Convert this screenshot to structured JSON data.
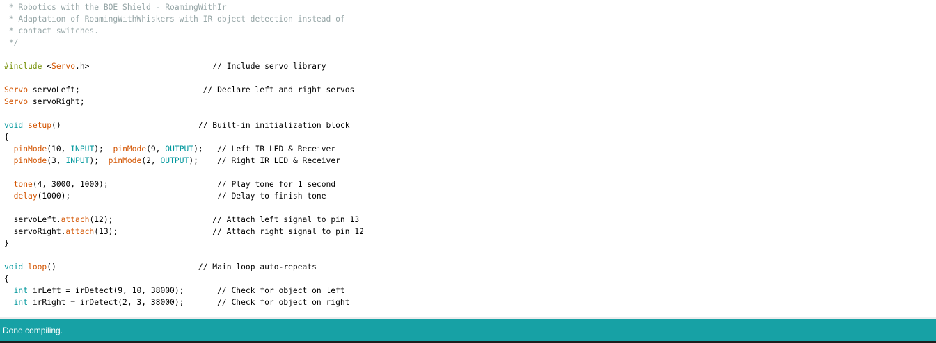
{
  "colors": {
    "comment": "#95a5a6",
    "keyword": "#d35400",
    "type": "#00979c",
    "preprocessor": "#728e00",
    "plain": "#000000",
    "status_bar_bg": "#17a1a5",
    "status_text": "#ffffff"
  },
  "editor": {
    "lines": [
      [
        {
          "t": " * Robotics with the BOE Shield - RoamingWithIr",
          "k": "comment"
        }
      ],
      [
        {
          "t": " * Adaptation of RoamingWithWhiskers with IR object detection instead of",
          "k": "comment"
        }
      ],
      [
        {
          "t": " * contact switches.",
          "k": "comment"
        }
      ],
      [
        {
          "t": " */",
          "k": "comment"
        }
      ],
      [],
      [
        {
          "t": "#include ",
          "k": "preproc"
        },
        {
          "t": "<",
          "k": "plain"
        },
        {
          "t": "Servo",
          "k": "keyword"
        },
        {
          "t": ".h>",
          "k": "plain"
        },
        {
          "t": "                          ",
          "k": "plain"
        },
        {
          "t": "// Include servo library",
          "k": "plain"
        }
      ],
      [],
      [
        {
          "t": "Servo",
          "k": "keyword"
        },
        {
          "t": " servoLeft;                          ",
          "k": "plain"
        },
        {
          "t": "// Declare left and right servos",
          "k": "plain"
        }
      ],
      [
        {
          "t": "Servo",
          "k": "keyword"
        },
        {
          "t": " servoRight;",
          "k": "plain"
        }
      ],
      [],
      [
        {
          "t": "void",
          "k": "type"
        },
        {
          "t": " ",
          "k": "plain"
        },
        {
          "t": "setup",
          "k": "keyword"
        },
        {
          "t": "()                             ",
          "k": "plain"
        },
        {
          "t": "// Built-in initialization block",
          "k": "plain"
        }
      ],
      [
        {
          "t": "{",
          "k": "plain"
        }
      ],
      [
        {
          "t": "  ",
          "k": "plain"
        },
        {
          "t": "pinMode",
          "k": "keyword"
        },
        {
          "t": "(10, ",
          "k": "plain"
        },
        {
          "t": "INPUT",
          "k": "type"
        },
        {
          "t": ");  ",
          "k": "plain"
        },
        {
          "t": "pinMode",
          "k": "keyword"
        },
        {
          "t": "(9, ",
          "k": "plain"
        },
        {
          "t": "OUTPUT",
          "k": "type"
        },
        {
          "t": ");   ",
          "k": "plain"
        },
        {
          "t": "// Left IR LED & Receiver",
          "k": "plain"
        }
      ],
      [
        {
          "t": "  ",
          "k": "plain"
        },
        {
          "t": "pinMode",
          "k": "keyword"
        },
        {
          "t": "(3, ",
          "k": "plain"
        },
        {
          "t": "INPUT",
          "k": "type"
        },
        {
          "t": ");  ",
          "k": "plain"
        },
        {
          "t": "pinMode",
          "k": "keyword"
        },
        {
          "t": "(2, ",
          "k": "plain"
        },
        {
          "t": "OUTPUT",
          "k": "type"
        },
        {
          "t": ");    ",
          "k": "plain"
        },
        {
          "t": "// Right IR LED & Receiver",
          "k": "plain"
        }
      ],
      [],
      [
        {
          "t": "  ",
          "k": "plain"
        },
        {
          "t": "tone",
          "k": "keyword"
        },
        {
          "t": "(4, 3000, 1000);                       ",
          "k": "plain"
        },
        {
          "t": "// Play tone for 1 second",
          "k": "plain"
        }
      ],
      [
        {
          "t": "  ",
          "k": "plain"
        },
        {
          "t": "delay",
          "k": "keyword"
        },
        {
          "t": "(1000);                               ",
          "k": "plain"
        },
        {
          "t": "// Delay to finish tone",
          "k": "plain"
        }
      ],
      [],
      [
        {
          "t": "  servoLeft.",
          "k": "plain"
        },
        {
          "t": "attach",
          "k": "keyword"
        },
        {
          "t": "(12);                     ",
          "k": "plain"
        },
        {
          "t": "// Attach left signal to pin 13",
          "k": "plain"
        }
      ],
      [
        {
          "t": "  servoRight.",
          "k": "plain"
        },
        {
          "t": "attach",
          "k": "keyword"
        },
        {
          "t": "(13);                    ",
          "k": "plain"
        },
        {
          "t": "// Attach right signal to pin 12",
          "k": "plain"
        }
      ],
      [
        {
          "t": "}",
          "k": "plain"
        }
      ],
      [],
      [
        {
          "t": "void",
          "k": "type"
        },
        {
          "t": " ",
          "k": "plain"
        },
        {
          "t": "loop",
          "k": "keyword"
        },
        {
          "t": "()                              ",
          "k": "plain"
        },
        {
          "t": "// Main loop auto-repeats",
          "k": "plain"
        }
      ],
      [
        {
          "t": "{",
          "k": "plain"
        }
      ],
      [
        {
          "t": "  ",
          "k": "plain"
        },
        {
          "t": "int",
          "k": "type"
        },
        {
          "t": " irLeft = irDetect(9, 10, 38000);       ",
          "k": "plain"
        },
        {
          "t": "// Check for object on left",
          "k": "plain"
        }
      ],
      [
        {
          "t": "  ",
          "k": "plain"
        },
        {
          "t": "int",
          "k": "type"
        },
        {
          "t": " irRight = irDetect(2, 3, 38000);       ",
          "k": "plain"
        },
        {
          "t": "// Check for object on right",
          "k": "plain"
        }
      ]
    ]
  },
  "status": {
    "message": "Done compiling."
  }
}
